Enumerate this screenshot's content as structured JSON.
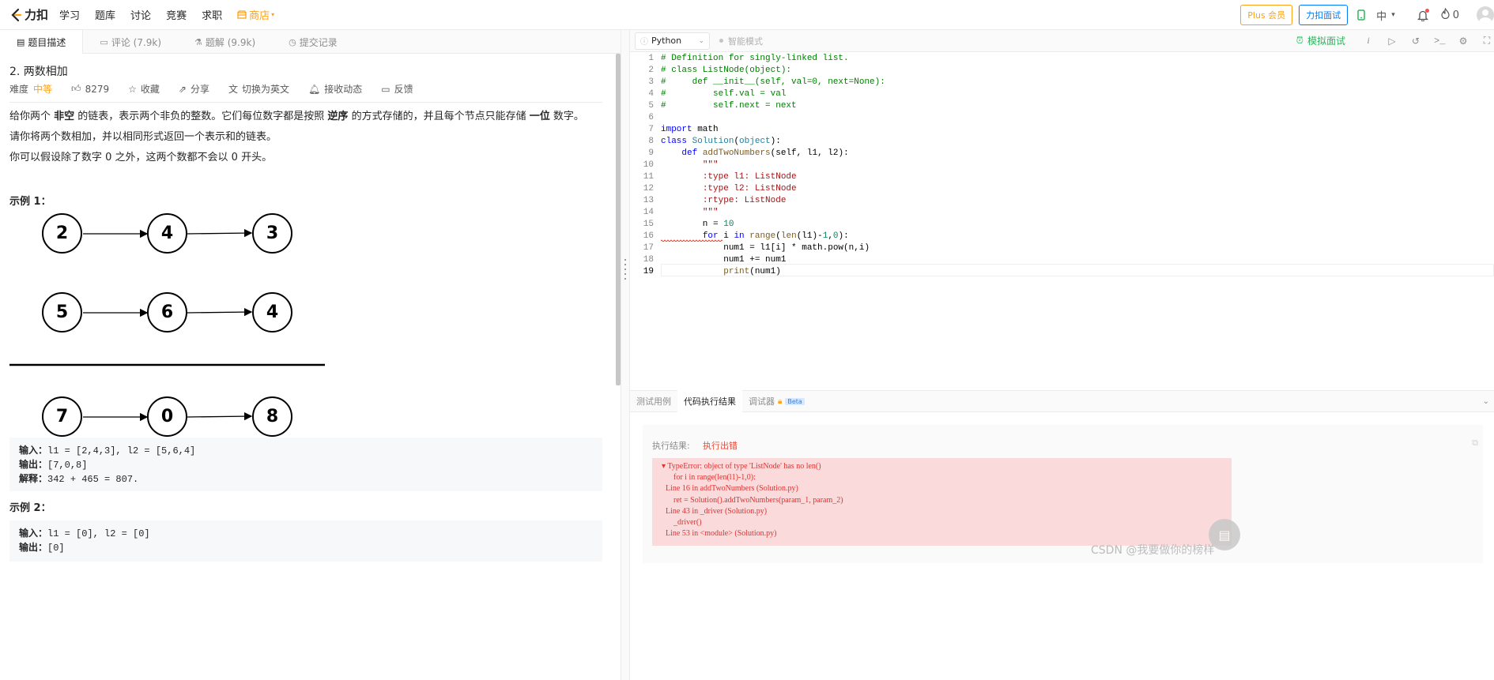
{
  "nav": {
    "logo_text": "力扣",
    "items": [
      "学习",
      "题库",
      "讨论",
      "竞赛",
      "求职"
    ],
    "shop": "商店",
    "plus": "Plus 会员",
    "interview": "力扣面试",
    "lang": "中",
    "streak": "0"
  },
  "left_tabs": [
    "题目描述",
    "评论 (7.9k)",
    "题解 (9.9k)",
    "提交记录"
  ],
  "problem": {
    "title": "2. 两数相加",
    "difficulty_label": "难度",
    "difficulty": "中等",
    "likes": "8279",
    "favorite": "收藏",
    "share": "分享",
    "switch_en": "切换为英文",
    "subscribe": "接收动态",
    "feedback": "反馈",
    "desc1": [
      "给你两个 ",
      "非空",
      " 的链表，表示两个非负的整数。它们每位数字都是按照 ",
      "逆序",
      " 的方式存储的，并且每个节点只能存储 ",
      "一位",
      " 数字。"
    ],
    "desc2": "请你将两个数相加，并以相同形式返回一个表示和的链表。",
    "desc3": "你可以假设除了数字 0 之外，这两个数都不会以 0 开头。",
    "example1_title": "示例 1：",
    "list_a": [
      "2",
      "4",
      "3"
    ],
    "list_b": [
      "5",
      "6",
      "4"
    ],
    "list_sum": [
      "7",
      "0",
      "8"
    ],
    "ex1": {
      "in_label": "输入：",
      "in": "l1 = [2,4,3], l2 = [5,6,4]",
      "out_label": "输出：",
      "out": "[7,0,8]",
      "exp_label": "解释：",
      "exp": "342 + 465 = 807."
    },
    "example2_title": "示例 2：",
    "ex2": {
      "in_label": "输入：",
      "in": "l1 = [0], l2 = [0]",
      "out_label": "输出：",
      "out": "[0]"
    }
  },
  "toolbar": {
    "language": "Python",
    "smart_mode": "智能模式",
    "mock_interview": "模拟面试"
  },
  "code": {
    "line_numbers": [
      "1",
      "2",
      "3",
      "4",
      "5",
      "6",
      "7",
      "8",
      "9",
      "10",
      "11",
      "12",
      "13",
      "14",
      "15",
      "16",
      "17",
      "18",
      "19"
    ]
  },
  "bottom_tabs": [
    "测试用例",
    "代码执行结果",
    "调试器",
    "Beta"
  ],
  "result": {
    "label": "执行结果:",
    "status": "执行出错",
    "error_lines": [
      "▾ TypeError: object of type 'ListNode' has no len()",
      "      for i in range(len(l1)-1,0):",
      "  Line 16 in addTwoNumbers (Solution.py)",
      "      ret = Solution().addTwoNumbers(param_1, param_2)",
      "  Line 43 in _driver (Solution.py)",
      "      _driver()",
      "  Line 53 in <module> (Solution.py)"
    ]
  },
  "watermark": "CSDN @我要做你的榜样"
}
